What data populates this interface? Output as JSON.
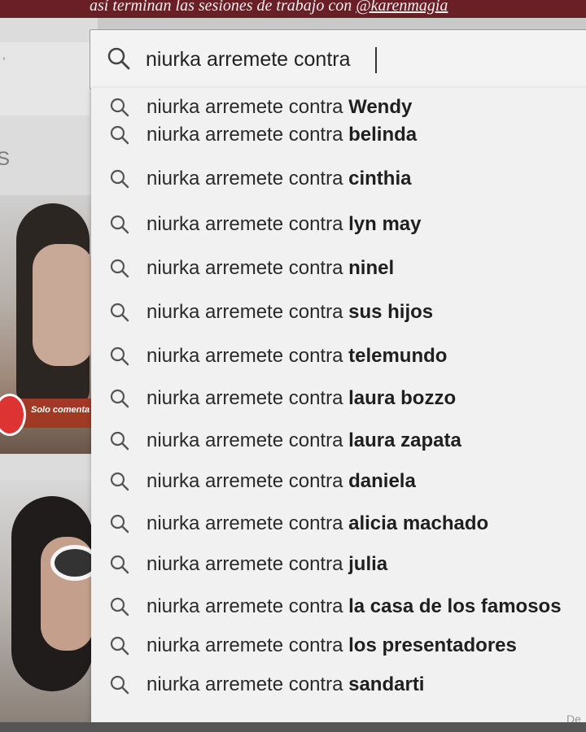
{
  "caption": {
    "text": "así terminan las sesiones de trabajo con ",
    "mention": "@karenmagia"
  },
  "left_panel": {
    "letter": "S",
    "banner_text": "Solo comenta"
  },
  "search": {
    "value": "niurka arremete contra ",
    "icon": "search-icon"
  },
  "suggestions": [
    {
      "prefix": "niurka arremete contra ",
      "completion": "Wendy"
    },
    {
      "prefix": "niurka arremete contra ",
      "completion": "belinda"
    },
    {
      "prefix": "niurka arremete contra ",
      "completion": "cinthia"
    },
    {
      "prefix": "niurka arremete contra ",
      "completion": "lyn may"
    },
    {
      "prefix": "niurka arremete contra ",
      "completion": "ninel"
    },
    {
      "prefix": "niurka arremete contra ",
      "completion": "sus hijos"
    },
    {
      "prefix": "niurka arremete contra ",
      "completion": "telemundo"
    },
    {
      "prefix": "niurka arremete contra ",
      "completion": "laura bozzo"
    },
    {
      "prefix": "niurka arremete contra ",
      "completion": "laura zapata"
    },
    {
      "prefix": "niurka arremete contra ",
      "completion": "daniela"
    },
    {
      "prefix": "niurka arremete contra ",
      "completion": "alicia machado"
    },
    {
      "prefix": "niurka arremete contra ",
      "completion": "julia"
    },
    {
      "prefix": "niurka arremete contra ",
      "completion": "la casa de los famosos"
    },
    {
      "prefix": "niurka arremete contra ",
      "completion": "los presentadores"
    },
    {
      "prefix": "niurka arremete contra ",
      "completion": "sandarti"
    }
  ],
  "corner_text": "De"
}
